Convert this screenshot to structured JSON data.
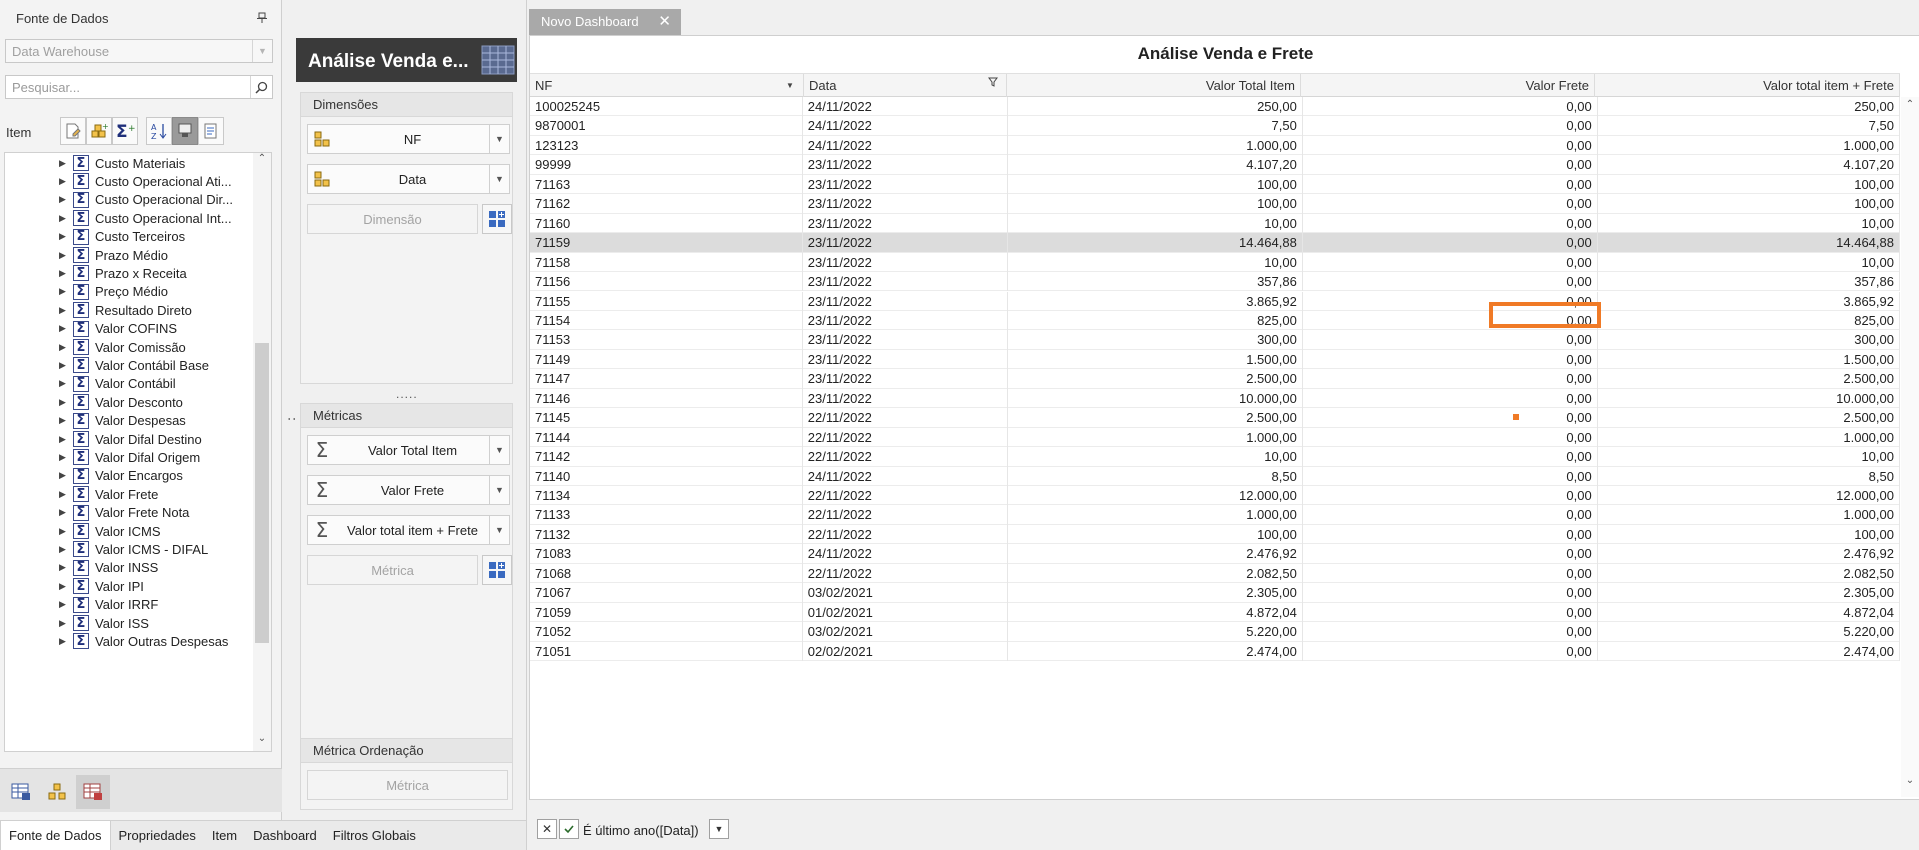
{
  "left_panel": {
    "title": "Fonte de Dados",
    "pin_glyph": "📌",
    "datasource_value": "Data Warehouse",
    "search_placeholder": "Pesquisar...",
    "item_label": "Item",
    "tree_items": [
      "Custo Materiais",
      "Custo Operacional Ati...",
      "Custo Operacional Dir...",
      "Custo Operacional Int...",
      "Custo Terceiros",
      "Prazo Médio",
      "Prazo x Receita",
      "Preço Médio",
      "Resultado Direto",
      "Valor COFINS",
      "Valor Comissão",
      "Valor Contábil Base",
      "Valor Contábil",
      "Valor Desconto",
      "Valor Despesas",
      "Valor Difal Destino",
      "Valor Difal Origem",
      "Valor Encargos",
      "Valor Frete",
      "Valor Frete Nota",
      "Valor ICMS",
      "Valor ICMS - DIFAL",
      "Valor INSS",
      "Valor IPI",
      "Valor IRRF",
      "Valor ISS",
      "Valor Outras Despesas"
    ]
  },
  "middle_panel": {
    "item_title": "Análise Venda e...",
    "dimensions_title": "Dimensões",
    "dimensions": [
      "NF",
      "Data"
    ],
    "dimension_placeholder": "Dimensão",
    "metrics_title": "Métricas",
    "metrics": [
      "Valor Total Item",
      "Valor Frete",
      "Valor total item + Frete"
    ],
    "metric_placeholder": "Métrica",
    "sort_metric_title": "Métrica Ordenação",
    "sort_metric_placeholder": "Métrica",
    "splitter_dots": "....."
  },
  "bottom_tabs": [
    "Fonte de Dados",
    "Propriedades",
    "Item",
    "Dashboard",
    "Filtros Globais"
  ],
  "dashboard": {
    "tab_label": "Novo Dashboard",
    "grid_title": "Análise Venda e Frete",
    "columns": [
      "NF",
      "Data",
      "Valor Total Item",
      "Valor Frete",
      "Valor total item + Frete"
    ],
    "rows": [
      [
        "100025245",
        "24/11/2022",
        "250,00",
        "0,00",
        "250,00"
      ],
      [
        "9870001",
        "24/11/2022",
        "7,50",
        "0,00",
        "7,50"
      ],
      [
        "123123",
        "24/11/2022",
        "1.000,00",
        "0,00",
        "1.000,00"
      ],
      [
        "99999",
        "23/11/2022",
        "4.107,20",
        "0,00",
        "4.107,20"
      ],
      [
        "71163",
        "23/11/2022",
        "100,00",
        "0,00",
        "100,00"
      ],
      [
        "71162",
        "23/11/2022",
        "100,00",
        "0,00",
        "100,00"
      ],
      [
        "71160",
        "23/11/2022",
        "10,00",
        "0,00",
        "10,00"
      ],
      [
        "71159",
        "23/11/2022",
        "14.464,88",
        "0,00",
        "14.464,88"
      ],
      [
        "71158",
        "23/11/2022",
        "10,00",
        "0,00",
        "10,00"
      ],
      [
        "71156",
        "23/11/2022",
        "357,86",
        "0,00",
        "357,86"
      ],
      [
        "71155",
        "23/11/2022",
        "3.865,92",
        "0,00",
        "3.865,92"
      ],
      [
        "71154",
        "23/11/2022",
        "825,00",
        "0,00",
        "825,00"
      ],
      [
        "71153",
        "23/11/2022",
        "300,00",
        "0,00",
        "300,00"
      ],
      [
        "71149",
        "23/11/2022",
        "1.500,00",
        "0,00",
        "1.500,00"
      ],
      [
        "71147",
        "23/11/2022",
        "2.500,00",
        "0,00",
        "2.500,00"
      ],
      [
        "71146",
        "23/11/2022",
        "10.000,00",
        "0,00",
        "10.000,00"
      ],
      [
        "71145",
        "22/11/2022",
        "2.500,00",
        "0,00",
        "2.500,00"
      ],
      [
        "71144",
        "22/11/2022",
        "1.000,00",
        "0,00",
        "1.000,00"
      ],
      [
        "71142",
        "22/11/2022",
        "10,00",
        "0,00",
        "10,00"
      ],
      [
        "71140",
        "24/11/2022",
        "8,50",
        "0,00",
        "8,50"
      ],
      [
        "71134",
        "22/11/2022",
        "12.000,00",
        "0,00",
        "12.000,00"
      ],
      [
        "71133",
        "22/11/2022",
        "1.000,00",
        "0,00",
        "1.000,00"
      ],
      [
        "71132",
        "22/11/2022",
        "100,00",
        "0,00",
        "100,00"
      ],
      [
        "71083",
        "24/11/2022",
        "2.476,92",
        "0,00",
        "2.476,92"
      ],
      [
        "71068",
        "22/11/2022",
        "2.082,50",
        "0,00",
        "2.082,50"
      ],
      [
        "71067",
        "03/02/2021",
        "2.305,00",
        "0,00",
        "2.305,00"
      ],
      [
        "71059",
        "01/02/2021",
        "4.872,04",
        "0,00",
        "4.872,04"
      ],
      [
        "71052",
        "03/02/2021",
        "5.220,00",
        "0,00",
        "5.220,00"
      ],
      [
        "71051",
        "02/02/2021",
        "2.474,00",
        "0,00",
        "2.474,00"
      ]
    ],
    "selected_row_nf": "71159",
    "filter_text": "É último ano([Data])",
    "filter_checked": true
  },
  "colors": {
    "accent": "#f07a26",
    "header_dark": "#3a3a3a",
    "selected_row": "#dcdcdc"
  }
}
